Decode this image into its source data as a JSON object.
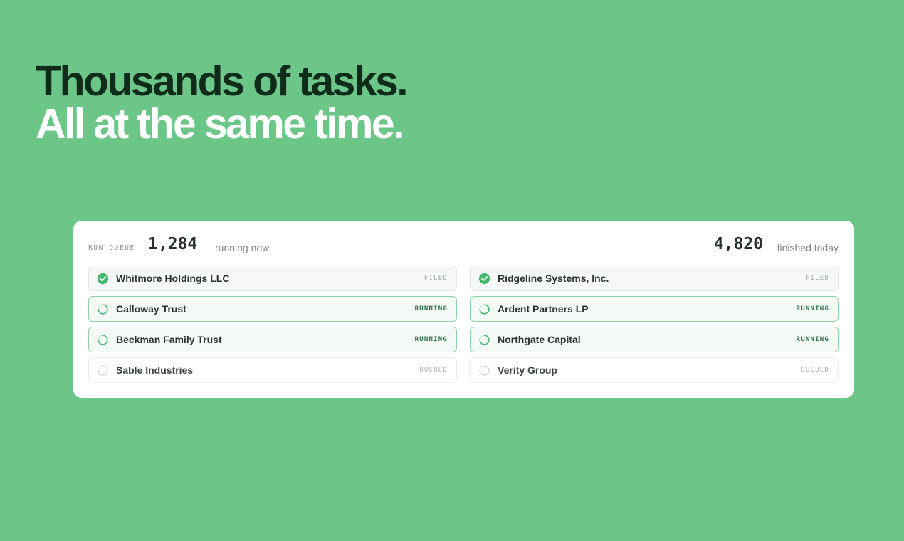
{
  "headline": {
    "line1": "Thousands of tasks.",
    "line2": "All at the same time."
  },
  "queue": {
    "label": "RUN QUEUE",
    "running_count": "1,284",
    "running_label": "running now",
    "finished_count": "4,820",
    "finished_label": "finished today"
  },
  "colors": {
    "background": "#6cc688",
    "headline_dark": "#0f2c1b",
    "headline_light": "#ffffff",
    "accent_green": "#43b96b"
  },
  "tasks": [
    {
      "name": "Whitmore Holdings LLC",
      "status": "FILED",
      "state": "filed",
      "icon": "check-circle-icon"
    },
    {
      "name": "Ridgeline Systems, Inc.",
      "status": "FILED",
      "state": "filed",
      "icon": "check-circle-icon"
    },
    {
      "name": "Calloway Trust",
      "status": "RUNNING",
      "state": "running",
      "icon": "spinner-icon"
    },
    {
      "name": "Ardent Partners LP",
      "status": "RUNNING",
      "state": "running",
      "icon": "spinner-icon"
    },
    {
      "name": "Beckman Family Trust",
      "status": "RUNNING",
      "state": "running",
      "icon": "spinner-icon"
    },
    {
      "name": "Northgate Capital",
      "status": "RUNNING",
      "state": "running",
      "icon": "spinner-icon"
    },
    {
      "name": "Sable Industries",
      "status": "QUEUED",
      "state": "queued",
      "icon": "spinner-idle-icon"
    },
    {
      "name": "Verity Group",
      "status": "QUEUED",
      "state": "queued",
      "icon": "spinner-idle-icon"
    }
  ]
}
